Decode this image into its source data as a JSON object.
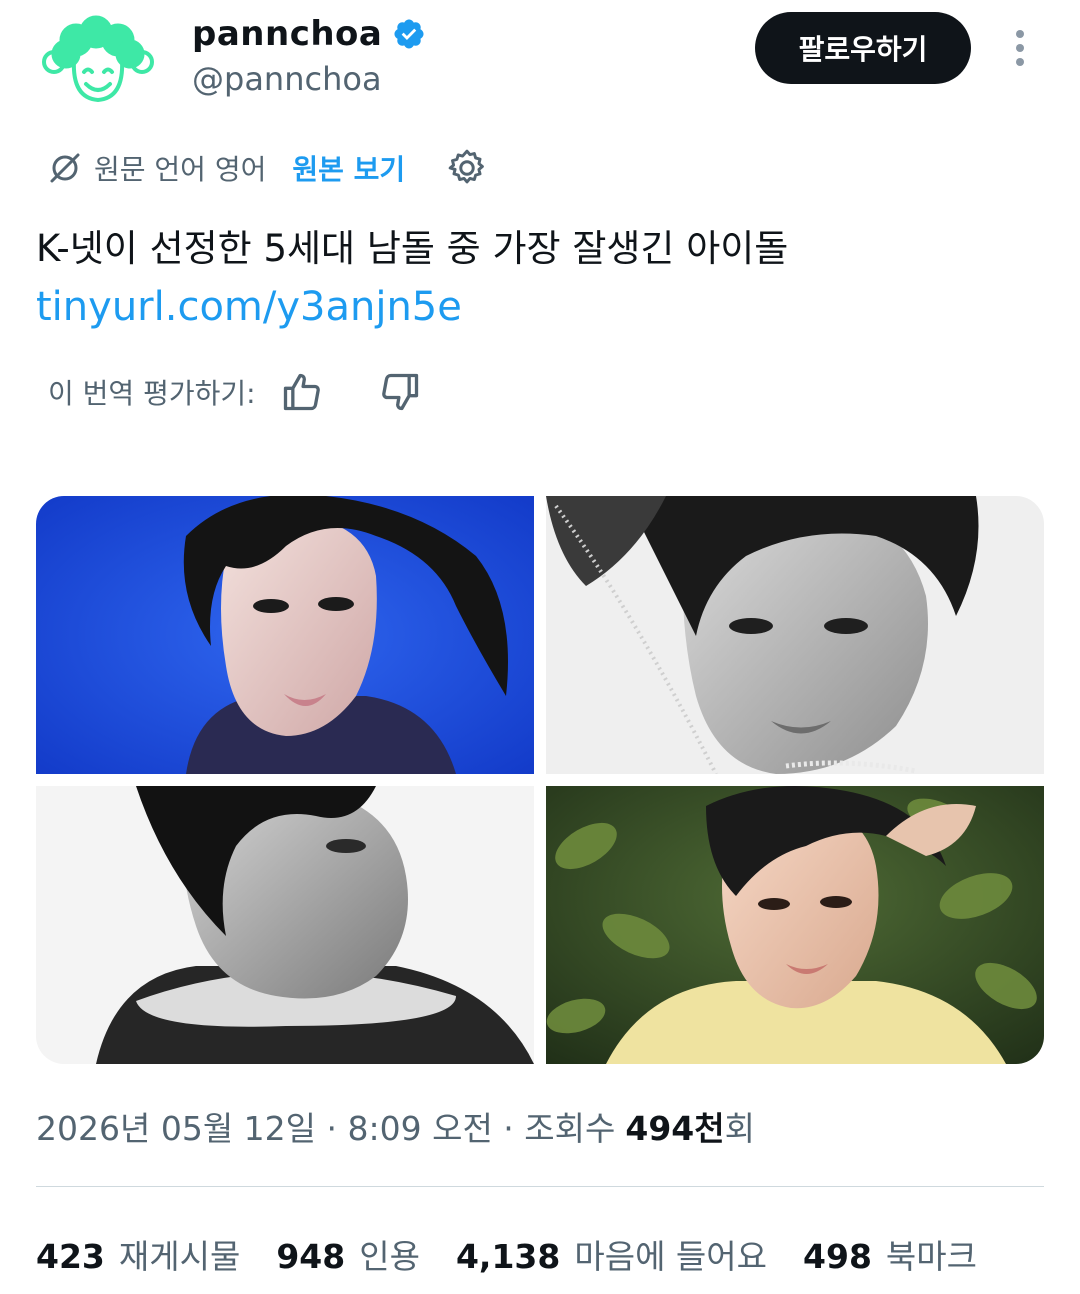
{
  "author": {
    "name": "pannchoa",
    "handle": "@pannchoa",
    "verified": true
  },
  "header": {
    "follow_label": "팔로우하기"
  },
  "translation": {
    "source_language_text": "원문 언어 영어",
    "show_original_label": "원본 보기",
    "rate_label": "이 번역 평가하기:"
  },
  "tweet": {
    "text": "K-넷이 선정한 5세대 남돌 중 가장 잘생긴 아이돌",
    "link": "tinyurl.com/y3anjn5e"
  },
  "media": {
    "photos": [
      {
        "alt": "photo-1"
      },
      {
        "alt": "photo-2"
      },
      {
        "alt": "photo-3"
      },
      {
        "alt": "photo-4"
      }
    ]
  },
  "meta": {
    "timestamp": "2026년 05월 12일 · 8:09 오전 · 조회수",
    "views_number": "494천",
    "views_suffix": "회"
  },
  "stats": {
    "reposts_count": "423",
    "reposts_label": "재게시물",
    "quotes_count": "948",
    "quotes_label": "인용",
    "likes_count": "4,138",
    "likes_label": "마음에 들어요",
    "bookmarks_count": "498",
    "bookmarks_label": "북마크"
  },
  "colors": {
    "accent": "#1d9bf0",
    "text_primary": "#0f1419",
    "text_secondary": "#536471",
    "avatar_mint": "#3ee8a6"
  },
  "icons": {
    "verified": "verified-badge-icon",
    "more": "more-vertical-icon",
    "translate": "translate-off-icon",
    "settings": "gear-icon",
    "thumbs_up": "thumbs-up-icon",
    "thumbs_down": "thumbs-down-icon"
  }
}
